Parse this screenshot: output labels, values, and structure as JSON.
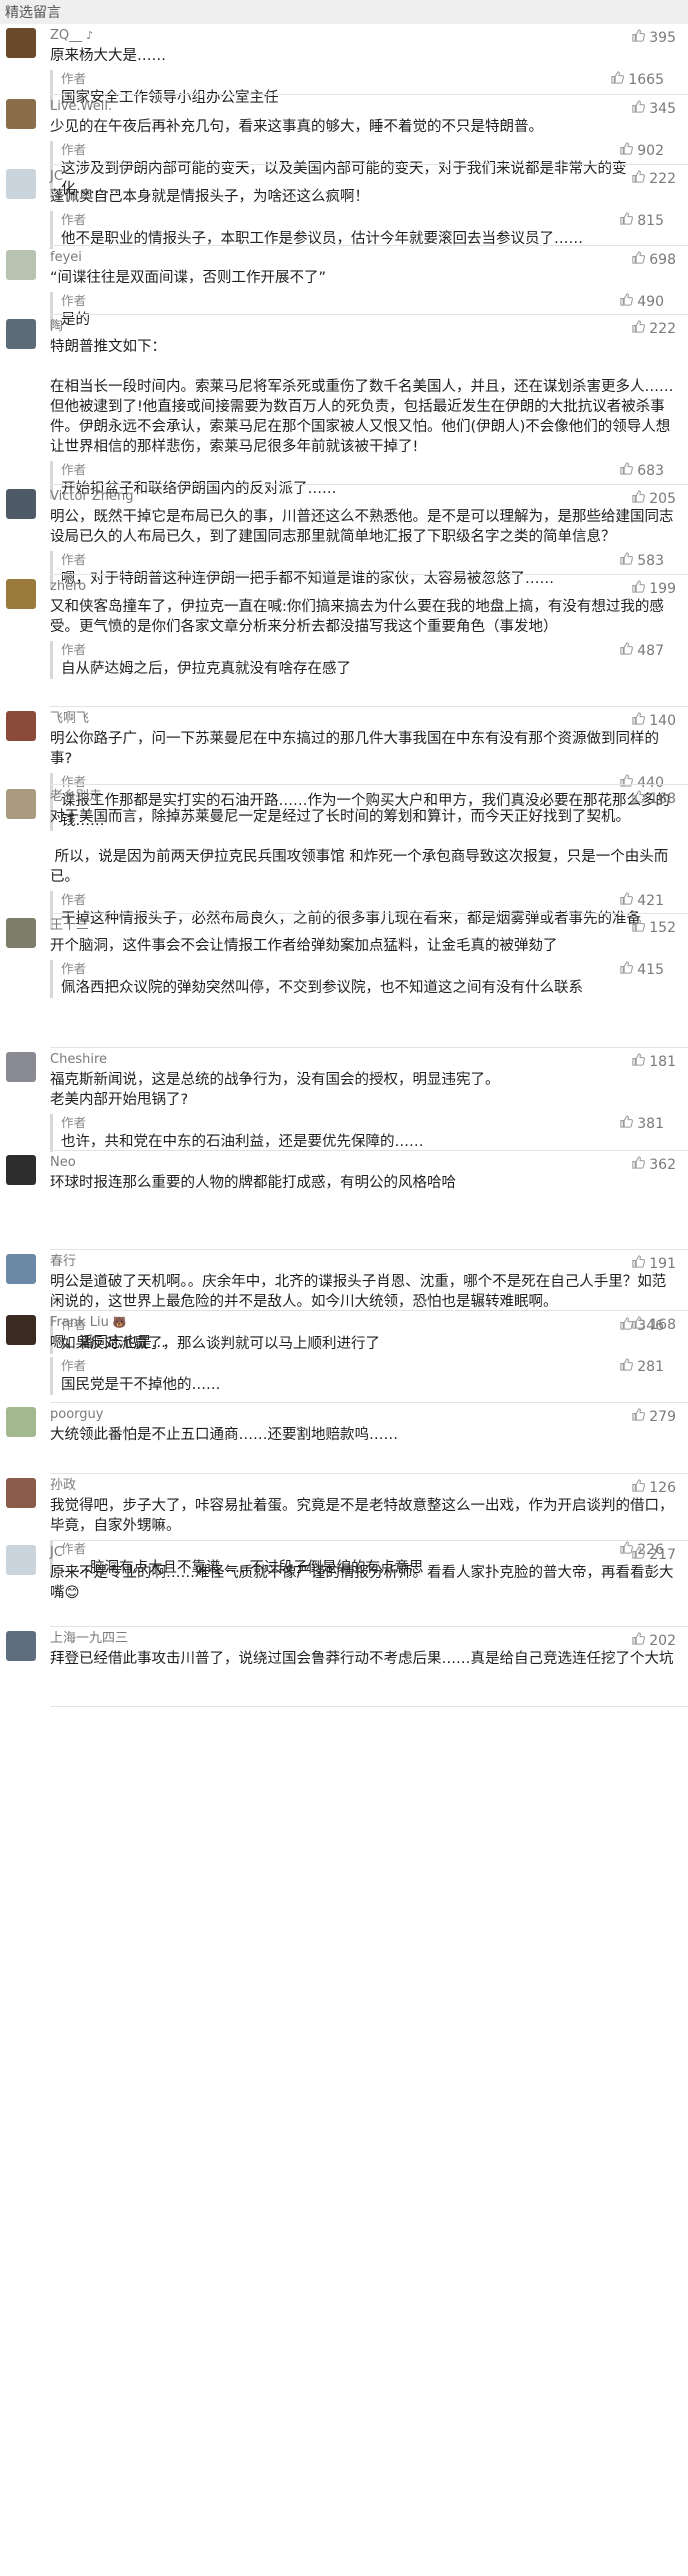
{
  "header": {
    "title": "精选留言"
  },
  "icons": {
    "like": "thumb-up-icon"
  },
  "comments": [
    {
      "name": "ZQ__",
      "tag": "♪",
      "avatar_color": "#6b4a2b",
      "likes": "395",
      "text": "原来杨大大是……",
      "reply": {
        "label": "作者",
        "text": "国家安全工作领导小组办公室主任",
        "likes": "1665"
      }
    },
    {
      "name": "Live.Well.",
      "avatar_color": "#8a6e4b",
      "likes": "345",
      "text": "少见的在午夜后再补充几句，看来这事真的够大，睡不着觉的不只是特朗普。",
      "reply": {
        "label": "作者",
        "text": "这涉及到伊朗内部可能的变天，以及美国内部可能的变天，对于我们来说都是非常大的变化………",
        "likes": "902"
      }
    },
    {
      "name": "JC",
      "avatar_color": "#c9d4dc",
      "likes": "222",
      "text": "蓬佩奥自己本身就是情报头子，为啥还这么疯啊！",
      "reply": {
        "label": "作者",
        "text": "他不是职业的情报头子，本职工作是参议员，估计今年就要滚回去当参议员了……",
        "likes": "815"
      }
    },
    {
      "name": "feyei",
      "avatar_color": "#b8c2b0",
      "likes": "698",
      "text": "“间谍往往是双面间谍，否则工作开展不了”",
      "reply": {
        "label": "作者",
        "text": "是的",
        "likes": "490"
      }
    },
    {
      "name": "陶",
      "avatar_color": "#5c6b78",
      "likes": "222",
      "text": "特朗普推文如下：\n\n在相当长一段时间内。索莱马尼将军杀死或重伤了数千名美国人，并且，还在谋划杀害更多人……但他被逮到了!他直接或间接需要为数百万人的死负责，包括最近发生在伊朗的大批抗议者被杀事件。伊朗永远不会承认，索莱马尼在那个国家被人又恨又怕。他们(伊朗人)不会像他们的领导人想让世界相信的那样悲伤，索莱马尼很多年前就该被干掉了!",
      "reply": {
        "label": "作者",
        "text": "开始扣盆子和联络伊朗国内的反对派了……",
        "likes": "683"
      }
    },
    {
      "name": "Victor Zheng",
      "avatar_color": "#4e5a66",
      "likes": "205",
      "text": "明公，既然干掉它是布局已久的事，川普还这么不熟悉他。是不是可以理解为，是那些给建国同志设局已久的人布局已久，到了建国同志那里就简单地汇报了下职级名字之类的简单信息？",
      "reply": {
        "label": "作者",
        "text": "嗯，对于特朗普这种连伊朗一把手都不知道是谁的家伙，太容易被忽悠了……",
        "likes": "583"
      }
    },
    {
      "name": "zhero",
      "avatar_color": "#9a7a3a",
      "likes": "199",
      "text": "又和侠客岛撞车了，伊拉克一直在喊:你们搞来搞去为什么要在我的地盘上搞，有没有想过我的感受。更气愤的是你们各家文章分析来分析去都没描写我这个重要角色（事发地）",
      "reply": {
        "label": "作者",
        "text": "自从萨达姆之后，伊拉克真就没有啥存在感了",
        "likes": "487"
      }
    },
    {
      "name": "飞啊飞",
      "avatar_color": "#8c4a3a",
      "likes": "140",
      "text": "明公你路子广，问一下苏莱曼尼在中东搞过的那几件大事我国在中东有没有那个资源做到同样的事?",
      "reply": {
        "label": "作者",
        "text": "谍报工作那都是实打实的石油开路……作为一个购买大户和甲方，我们真没必要在那花那么多的钱……",
        "likes": "440"
      }
    },
    {
      "name": "老乡别走",
      "avatar_color": "#a99a80",
      "likes": "168",
      "text": "对于美国而言，除掉苏莱曼尼一定是经过了长时间的筹划和算计，而今天正好找到了契机。\n\n 所以，说是因为前两天伊拉克民兵围攻领事馆 和炸死一个承包商导致这次报复，只是一个由头而已。",
      "reply": {
        "label": "作者",
        "text": "干掉这种情报头子，必然布局良久，之前的很多事儿现在看来，都是烟雾弹或者事先的准备",
        "likes": "421"
      }
    },
    {
      "name": "王十三",
      "avatar_color": "#7d7d6a",
      "likes": "152",
      "text": "开个脑洞，这件事会不会让情报工作者给弹劾案加点猛料，让金毛真的被弹劾了",
      "reply": {
        "label": "作者",
        "text": "佩洛西把众议院的弹劾突然叫停，不交到参议院，也不知道这之间有没有什么联系",
        "likes": "415"
      }
    },
    {
      "name": "Cheshire",
      "avatar_color": "#8a8a94",
      "likes": "181",
      "text": "福克斯新闻说，这是总统的战争行为，没有国会的授权，明显违宪了。\n老美内部开始甩锅了?",
      "reply": {
        "label": "作者",
        "text": "也许，共和党在中东的石油利益，还是要优先保障的……",
        "likes": "381"
      }
    },
    {
      "name": "Neo",
      "avatar_color": "#2d2d2d",
      "likes": "362",
      "text": "环球时报连那么重要的人物的牌都能打成惑，有明公的风格哈哈",
      "reply": null
    },
    {
      "name": "春行",
      "avatar_color": "#6c8aa8",
      "likes": "191",
      "text": "明公是道破了天机啊。。庆余年中，北齐的谍报头子肖恩、沈重，哪个不是死在自己人手里？如范闲说的，这世界上最危险的并不是敌人。如今川大统领，恐怕也是辗转难眠啊。",
      "reply": {
        "label": "作者",
        "text": "如果反对派赢了，那么谈判就可以马上顺利进行了",
        "likes": "346"
      }
    },
    {
      "name": "Frank Liu",
      "tag": "🐻",
      "avatar_color": "#3a2a22",
      "likes": "168",
      "text": "嗯，潘同志也是…",
      "reply": {
        "label": "作者",
        "text": "国民党是干不掉他的……",
        "likes": "281"
      }
    },
    {
      "name": "poorguy",
      "avatar_color": "#a4b890",
      "likes": "279",
      "text": "大统领此番怕是不止五口通商……还要割地赔款呜……",
      "reply": null
    },
    {
      "name": "孙政",
      "avatar_color": "#8a5a4a",
      "likes": "126",
      "text": "我觉得吧，步子大了，咔容易扯着蛋。究竟是不是老特故意整这么一出戏，作为开启谈判的借口，毕竟，自家外甥嘛。",
      "reply": {
        "label": "作者",
        "text": "……脑洞有点大且不靠谱……不过段子倒是编的有点意思",
        "likes": "226"
      }
    },
    {
      "name": "JC",
      "avatar_color": "#c9d4dc",
      "likes": "217",
      "text": "原来不是专业的啊……难怪气质就不像严谨的情报分析师。看看人家扑克脸的普大帝，再看看彭大嘴😊",
      "reply": null
    },
    {
      "name": "上海一九四三",
      "avatar_color": "#5e6e7e",
      "likes": "202",
      "text": "拜登已经借此事攻击川普了，说绕过国会鲁莽行动不考虑后果……真是给自己竞选连任挖了个大坑",
      "reply": null
    }
  ]
}
